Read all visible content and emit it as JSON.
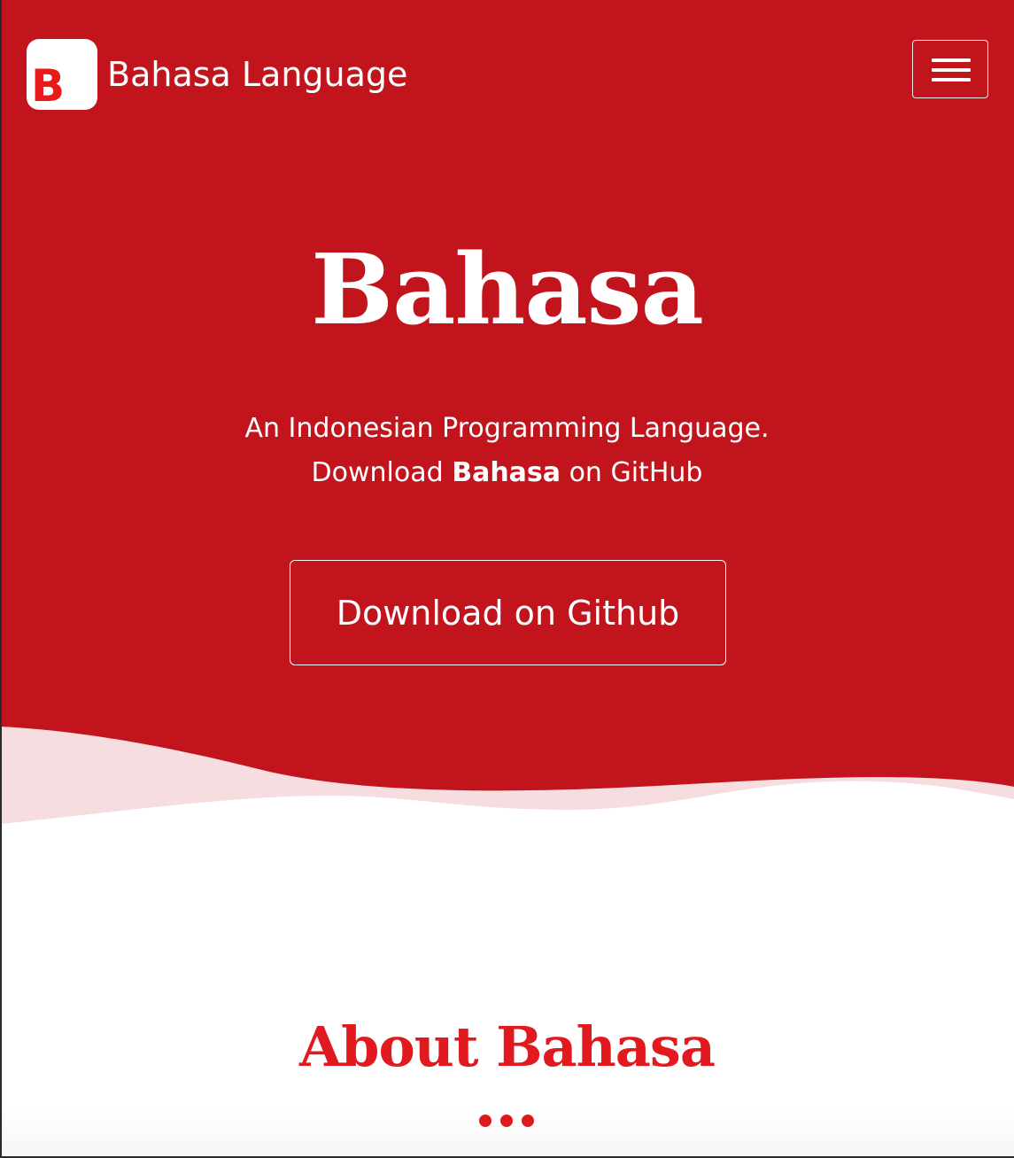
{
  "navbar": {
    "logo_letter": "B",
    "brand_name": "Bahasa Language",
    "menu_toggle_icon": "hamburger-menu-icon"
  },
  "hero": {
    "title": "Bahasa",
    "subtitle_line1": "An Indonesian Programming Language.",
    "subtitle_line2_prefix": "Download ",
    "subtitle_line2_bold": "Bahasa",
    "subtitle_line2_suffix": " on GitHub",
    "download_button_label": "Download on Github"
  },
  "about": {
    "title": "About Bahasa"
  },
  "colors": {
    "hero_background": "#c1141d",
    "wave_light": "#f6dde0",
    "accent_red": "#e01a1f",
    "text_on_hero": "#ffffff"
  }
}
